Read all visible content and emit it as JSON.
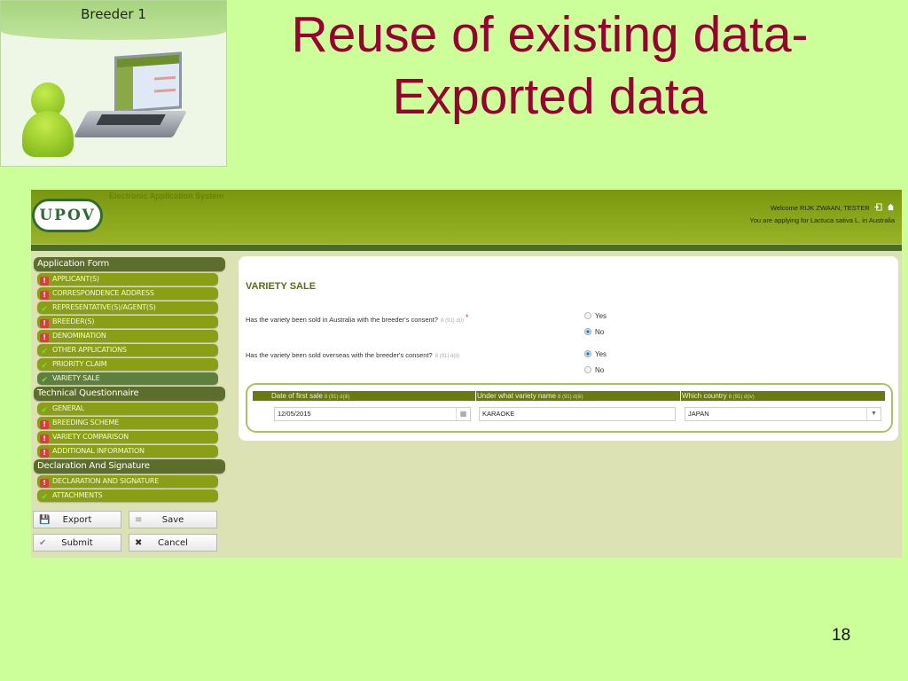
{
  "slide": {
    "title_line1": "Reuse of existing data-",
    "title_line2": "Exported data",
    "page_number": "18",
    "breeder_label": "Breeder 1"
  },
  "app": {
    "system_name": "Electronic Application System",
    "logo": "UPOV",
    "welcome": "Welcome RIJK ZWAAN, TESTER",
    "applying_for": "You are applying for Lactuca sativa L. in Australia",
    "icons": {
      "logout": "logout-icon",
      "home": "home-icon"
    }
  },
  "sidebar": {
    "sections": [
      {
        "label": "Application Form",
        "items": [
          {
            "label": "APPLICANT(S)",
            "status": "error"
          },
          {
            "label": "CORRESPONDENCE ADDRESS",
            "status": "error"
          },
          {
            "label": "REPRESENTATIVE(S)/AGENT(S)",
            "status": "ok"
          },
          {
            "label": "BREEDER(S)",
            "status": "error"
          },
          {
            "label": "DENOMINATION",
            "status": "error"
          },
          {
            "label": "OTHER APPLICATIONS",
            "status": "ok"
          },
          {
            "label": "PRIORITY CLAIM",
            "status": "ok"
          },
          {
            "label": "VARIETY SALE",
            "status": "ok",
            "active": true
          }
        ]
      },
      {
        "label": "Technical Questionnaire",
        "items": [
          {
            "label": "GENERAL",
            "status": "ok"
          },
          {
            "label": "BREEDING SCHEME",
            "status": "error"
          },
          {
            "label": "VARIETY COMPARISON",
            "status": "error"
          },
          {
            "label": "ADDITIONAL INFORMATION",
            "status": "error"
          }
        ]
      },
      {
        "label": "Declaration And Signature",
        "items": [
          {
            "label": "DECLARATION AND SIGNATURE",
            "status": "error"
          },
          {
            "label": "ATTACHMENTS",
            "status": "ok"
          }
        ]
      }
    ],
    "status_glyphs": {
      "error": "!",
      "ok": "✔"
    }
  },
  "buttons": {
    "export": {
      "label": "Export",
      "icon": "💾"
    },
    "save": {
      "label": "Save",
      "icon": "≡"
    },
    "submit": {
      "label": "Submit",
      "icon": "✔"
    },
    "cancel": {
      "label": "Cancel",
      "icon": "✖"
    }
  },
  "form": {
    "title": "VARIETY SALE",
    "q1": {
      "text": "Has the variety been sold in Australia with the breeder's consent?",
      "ref": "8 (91) d(i)",
      "required_mark": "*",
      "options": [
        "Yes",
        "No"
      ],
      "selected": "No"
    },
    "q2": {
      "text": "Has the variety been sold overseas with the breeder's consent?",
      "ref": "8 (91) d(ii)",
      "options": [
        "Yes",
        "No"
      ],
      "selected": "Yes"
    },
    "sale_table": {
      "columns": [
        {
          "label": "Date of first sale",
          "ref": "8 (91) d(iii)"
        },
        {
          "label": "Under what variety name",
          "ref": "8 (91) d(iii)"
        },
        {
          "label": "Which country",
          "ref": "8 (91) d(iv)"
        }
      ],
      "row": {
        "date": "12/05/2015",
        "variety_name": "KARAOKE",
        "country": "JAPAN"
      }
    }
  }
}
